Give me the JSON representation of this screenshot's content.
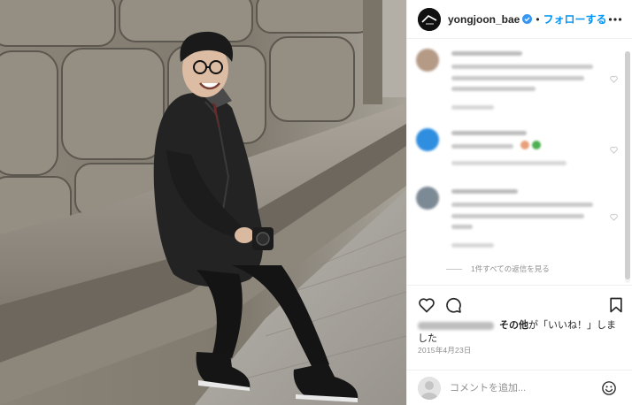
{
  "photo": {
    "description_icon": "photo-man-sitting-stone-bench"
  },
  "header": {
    "username": "yongjoon_bae",
    "separator": "•",
    "follow_label": "フォローする",
    "verified_icon": "verified-badge-icon",
    "more_icon": "more-options-icon"
  },
  "comments": {
    "view_replies_label": "1件すべての返信を見る"
  },
  "actions": {
    "like_icon": "heart-icon",
    "comment_icon": "comment-icon",
    "save_icon": "bookmark-icon"
  },
  "likes": {
    "others_label": "その他",
    "suffix": "が「いいね！」しました"
  },
  "post": {
    "date": "2015年4月23日"
  },
  "comment_box": {
    "placeholder": "コメントを追加...",
    "emoji_icon": "emoji-icon"
  },
  "colors": {
    "accent": "#0095f6",
    "text": "#262626",
    "secondary": "#8e8e8e"
  }
}
